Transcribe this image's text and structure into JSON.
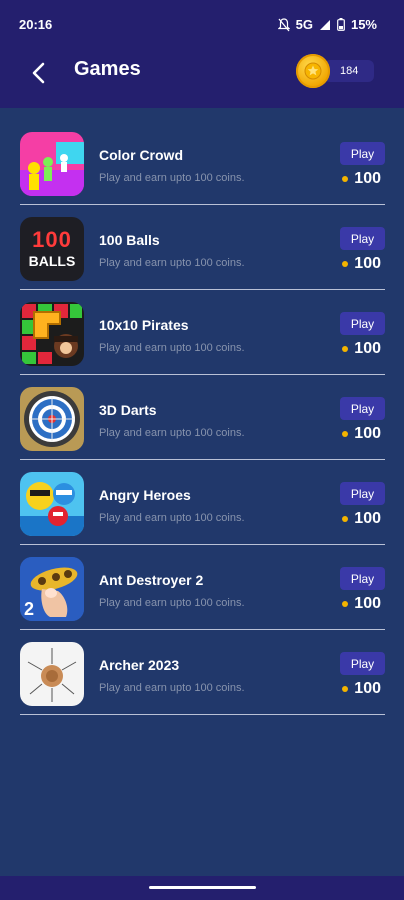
{
  "status": {
    "time": "20:16",
    "network": "5G",
    "battery": "15%"
  },
  "header": {
    "title": "Games",
    "coins": "184"
  },
  "games": [
    {
      "name": "Color Crowd",
      "desc": "Play and earn upto 100 coins.",
      "play": "Play",
      "reward": "100",
      "icon": "color-crowd-icon"
    },
    {
      "name": "100 Balls",
      "desc": "Play and earn upto 100 coins.",
      "play": "Play",
      "reward": "100",
      "icon": "100-balls-icon",
      "thumb_text_top": "100",
      "thumb_text_bottom": "BALLS"
    },
    {
      "name": "10x10 Pirates",
      "desc": "Play and earn upto 100 coins.",
      "play": "Play",
      "reward": "100",
      "icon": "pirates-icon"
    },
    {
      "name": "3D Darts",
      "desc": "Play and earn upto 100 coins.",
      "play": "Play",
      "reward": "100",
      "icon": "darts-icon"
    },
    {
      "name": "Angry Heroes",
      "desc": "Play and earn upto 100 coins.",
      "play": "Play",
      "reward": "100",
      "icon": "angry-heroes-icon"
    },
    {
      "name": "Ant Destroyer 2",
      "desc": "Play and earn upto 100 coins.",
      "play": "Play",
      "reward": "100",
      "icon": "ant-destroyer-icon",
      "thumb_text": "2"
    },
    {
      "name": "Archer 2023",
      "desc": "Play and earn upto 100 coins.",
      "play": "Play",
      "reward": "100",
      "icon": "archer-icon"
    }
  ],
  "colors": {
    "background": "#21386b",
    "header": "#241f6e",
    "play_button": "#3a39a8",
    "coin": "#f3b400"
  }
}
